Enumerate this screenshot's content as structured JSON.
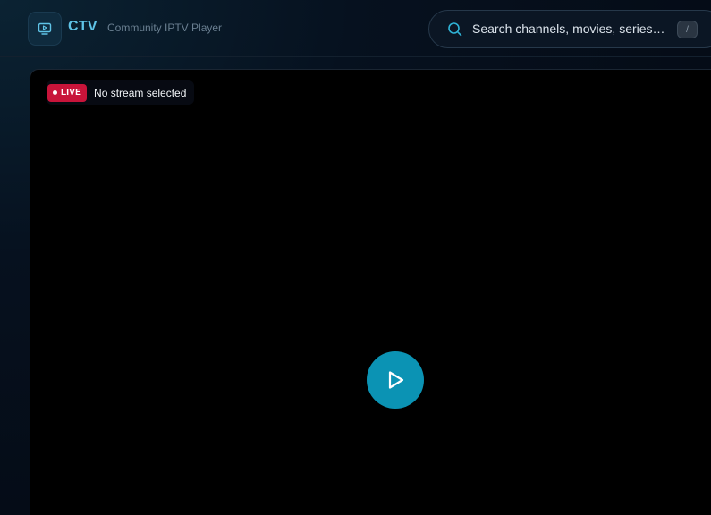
{
  "header": {
    "brand": "CTV",
    "tagline": "Community IPTV Player",
    "logo_icon": "tv-icon"
  },
  "search": {
    "placeholder": "Search channels, movies, series…",
    "shortcut": "/",
    "icon": "search-icon"
  },
  "player": {
    "live_label": "LIVE",
    "status": "No stream selected",
    "play_icon": "play-icon"
  },
  "colors": {
    "accent": "#0b93b4",
    "brand": "#5fc3e6",
    "live": "#c8143a"
  }
}
